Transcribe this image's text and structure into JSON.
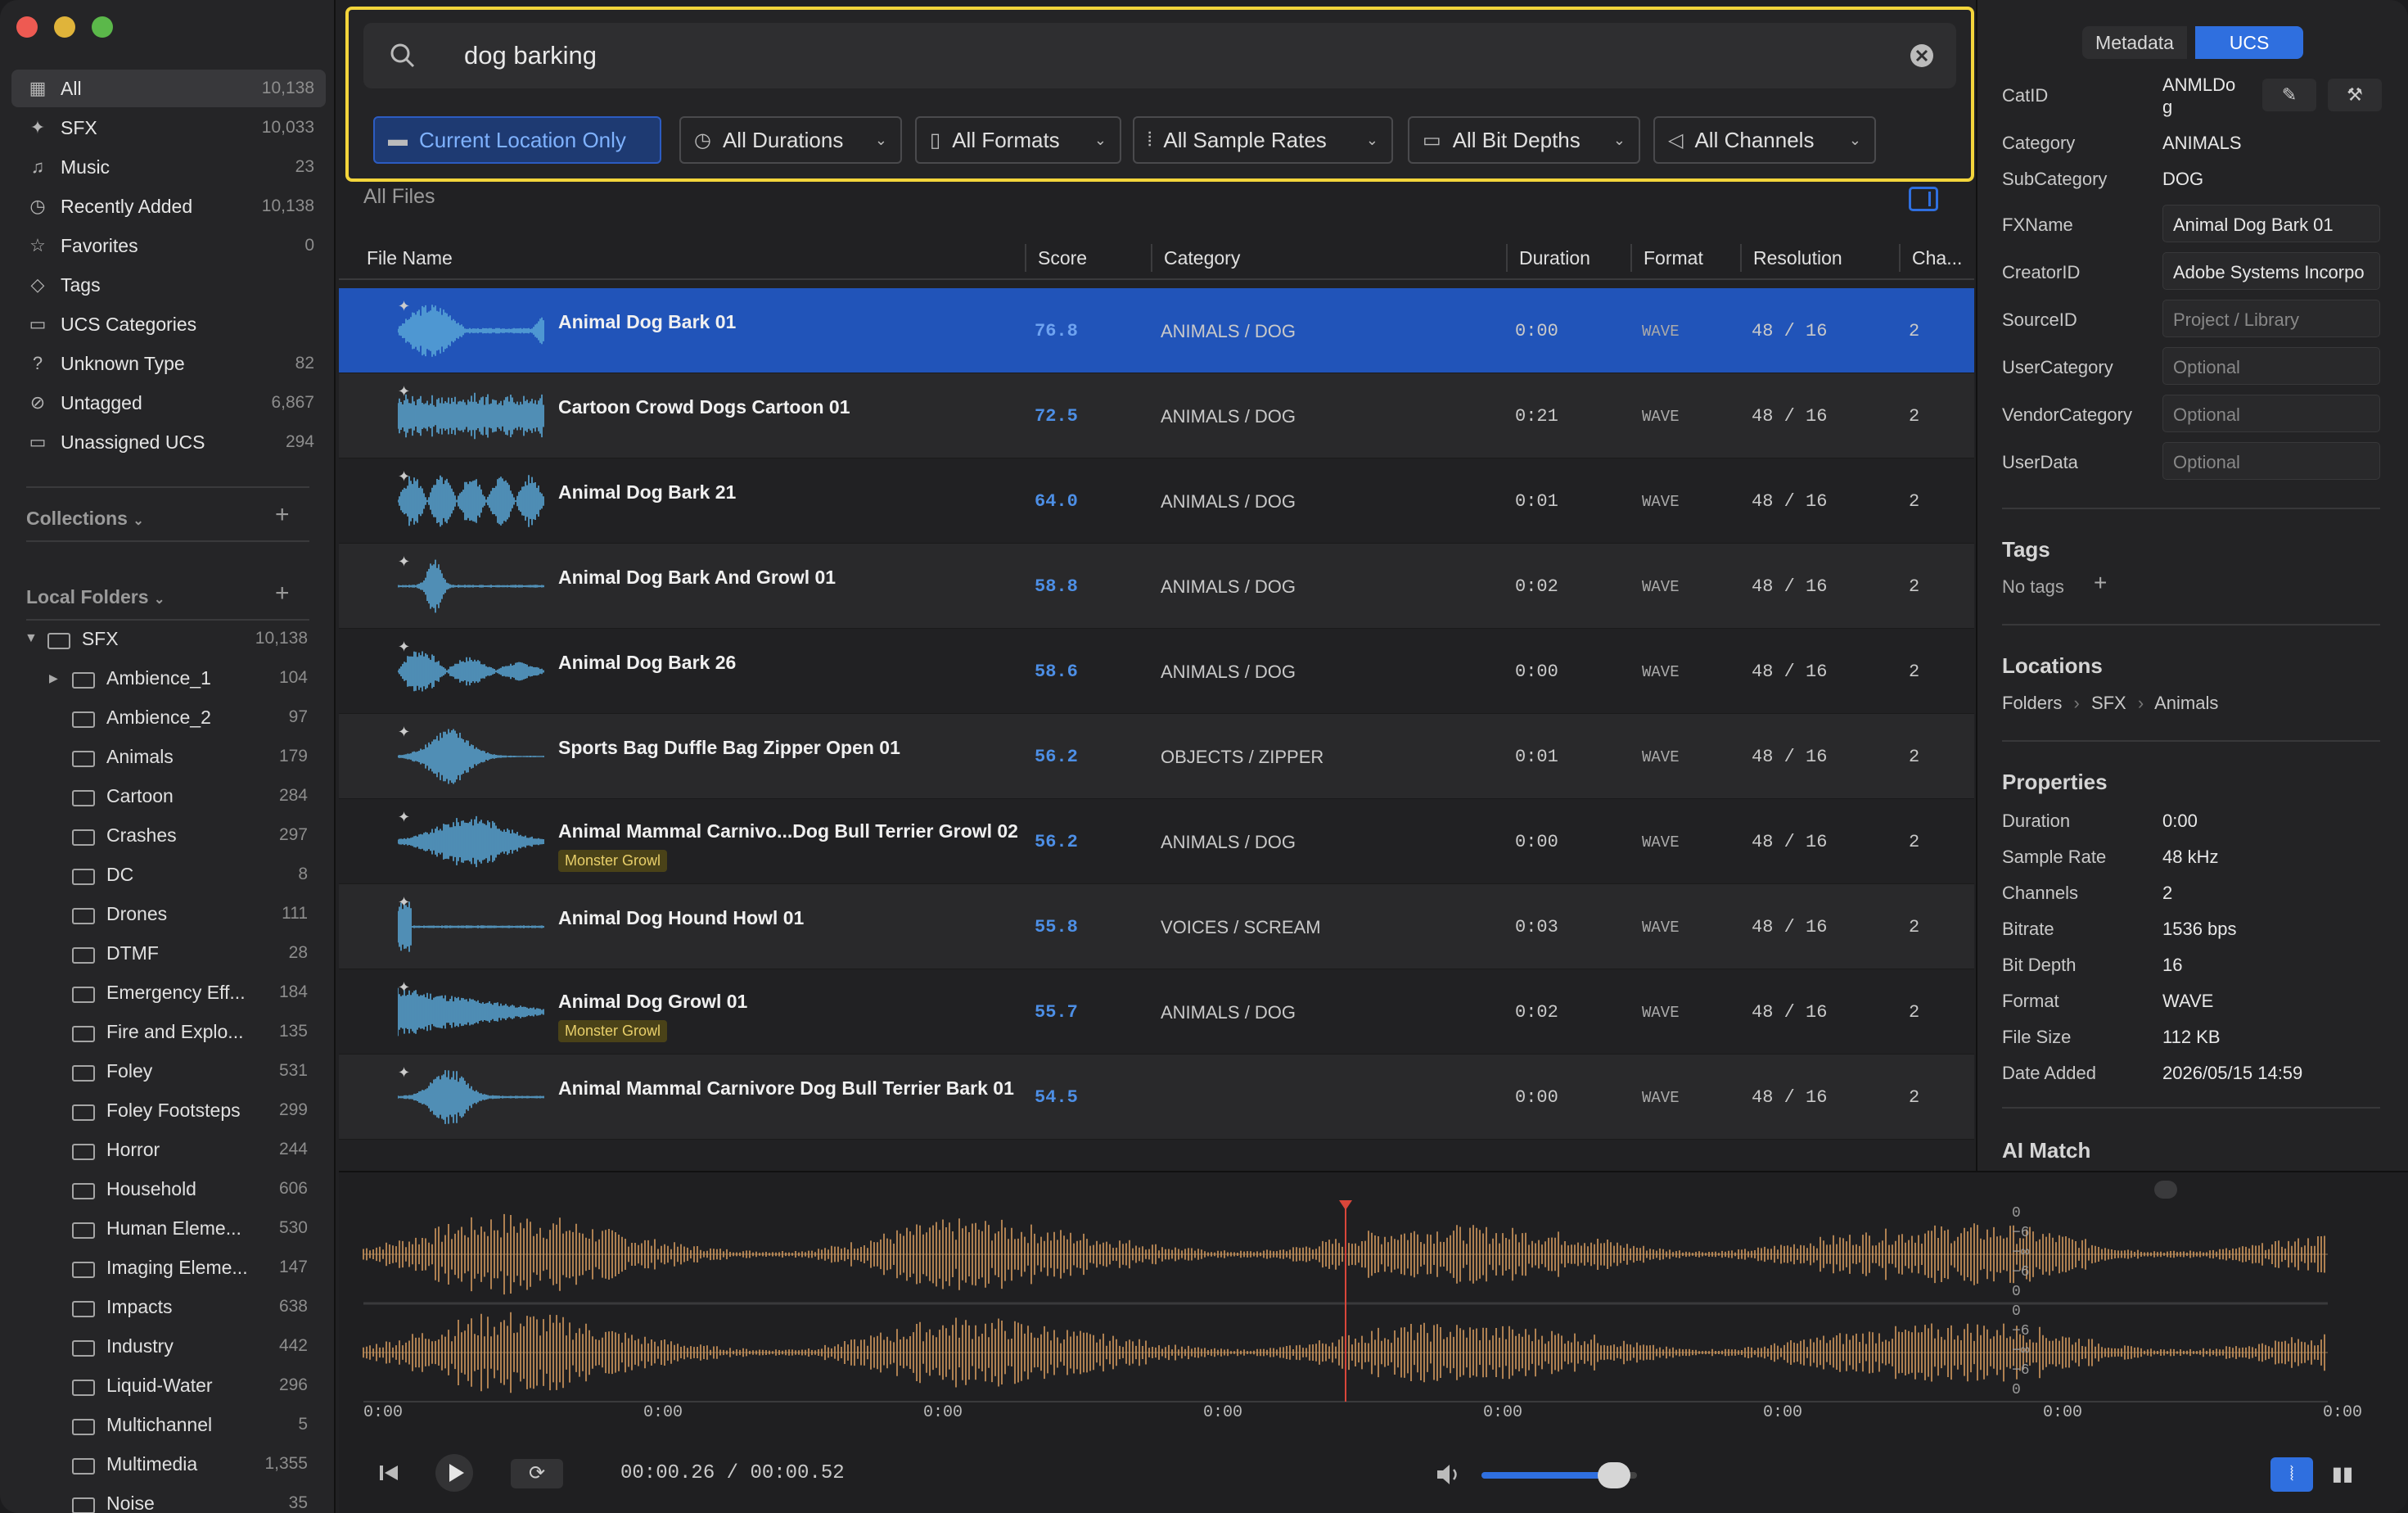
{
  "window": {
    "controls": [
      "close",
      "minimize",
      "zoom"
    ]
  },
  "sidebar": {
    "library": [
      {
        "label": "All",
        "count": "10,138",
        "icon": "grid-icon"
      },
      {
        "label": "SFX",
        "count": "10,033",
        "icon": "sparkle-icon"
      },
      {
        "label": "Music",
        "count": "23",
        "icon": "music-note-icon"
      },
      {
        "label": "Recently Added",
        "count": "10,138",
        "icon": "clock-icon"
      },
      {
        "label": "Favorites",
        "count": "0",
        "icon": "star-icon"
      },
      {
        "label": "Tags",
        "count": "",
        "icon": "tag-icon"
      },
      {
        "label": "UCS Categories",
        "count": "",
        "icon": "folder-icon"
      },
      {
        "label": "Unknown Type",
        "count": "82",
        "icon": "question-icon"
      },
      {
        "label": "Untagged",
        "count": "6,867",
        "icon": "untagged-icon"
      },
      {
        "label": "Unassigned UCS",
        "count": "294",
        "icon": "folder-icon"
      }
    ],
    "collections_label": "Collections",
    "local_folders_label": "Local Folders",
    "root_folder": {
      "label": "SFX",
      "count": "10,138"
    },
    "folders": [
      {
        "label": "Ambience_1",
        "count": "104"
      },
      {
        "label": "Ambience_2",
        "count": "97"
      },
      {
        "label": "Animals",
        "count": "179"
      },
      {
        "label": "Cartoon",
        "count": "284"
      },
      {
        "label": "Crashes",
        "count": "297"
      },
      {
        "label": "DC",
        "count": "8"
      },
      {
        "label": "Drones",
        "count": "111"
      },
      {
        "label": "DTMF",
        "count": "28"
      },
      {
        "label": "Emergency Eff...",
        "count": "184"
      },
      {
        "label": "Fire and Explo...",
        "count": "135"
      },
      {
        "label": "Foley",
        "count": "531"
      },
      {
        "label": "Foley Footsteps",
        "count": "299"
      },
      {
        "label": "Horror",
        "count": "244"
      },
      {
        "label": "Household",
        "count": "606"
      },
      {
        "label": "Human Eleme...",
        "count": "530"
      },
      {
        "label": "Imaging Eleme...",
        "count": "147"
      },
      {
        "label": "Impacts",
        "count": "638"
      },
      {
        "label": "Industry",
        "count": "442"
      },
      {
        "label": "Liquid-Water",
        "count": "296"
      },
      {
        "label": "Multichannel",
        "count": "5"
      },
      {
        "label": "Multimedia",
        "count": "1,355"
      },
      {
        "label": "Noise",
        "count": "35"
      }
    ]
  },
  "search": {
    "query": "dog barking",
    "filters": [
      {
        "label": "Current Location Only",
        "icon": "folder-icon"
      },
      {
        "label": "All Durations",
        "icon": "clock-icon"
      },
      {
        "label": "All Formats",
        "icon": "file-icon"
      },
      {
        "label": "All Sample Rates",
        "icon": "waveform-icon"
      },
      {
        "label": "All Bit Depths",
        "icon": "bit-depth-icon"
      },
      {
        "label": "All Channels",
        "icon": "speaker-icon"
      }
    ]
  },
  "list": {
    "title": "All Files",
    "columns": [
      "File Name",
      "Score",
      "Category",
      "Duration",
      "Format",
      "Resolution",
      "Cha..."
    ],
    "rows": [
      {
        "name": "Animal Dog Bark 01",
        "score": "76.8",
        "category": "ANIMALS / DOG",
        "duration": "0:00",
        "format": "WAVE",
        "resolution": "48 / 16",
        "channels": "2",
        "tag": ""
      },
      {
        "name": "Cartoon Crowd Dogs Cartoon 01",
        "score": "72.5",
        "category": "ANIMALS / DOG",
        "duration": "0:21",
        "format": "WAVE",
        "resolution": "48 / 16",
        "channels": "2",
        "tag": ""
      },
      {
        "name": "Animal Dog Bark 21",
        "score": "64.0",
        "category": "ANIMALS / DOG",
        "duration": "0:01",
        "format": "WAVE",
        "resolution": "48 / 16",
        "channels": "2",
        "tag": ""
      },
      {
        "name": "Animal Dog Bark And Growl 01",
        "score": "58.8",
        "category": "ANIMALS / DOG",
        "duration": "0:02",
        "format": "WAVE",
        "resolution": "48 / 16",
        "channels": "2",
        "tag": ""
      },
      {
        "name": "Animal Dog Bark 26",
        "score": "58.6",
        "category": "ANIMALS / DOG",
        "duration": "0:00",
        "format": "WAVE",
        "resolution": "48 / 16",
        "channels": "2",
        "tag": ""
      },
      {
        "name": "Sports Bag Duffle Bag Zipper Open 01",
        "score": "56.2",
        "category": "OBJECTS / ZIPPER",
        "duration": "0:01",
        "format": "WAVE",
        "resolution": "48 / 16",
        "channels": "2",
        "tag": ""
      },
      {
        "name": "Animal Mammal Carnivo...Dog Bull Terrier Growl 02",
        "score": "56.2",
        "category": "ANIMALS / DOG",
        "duration": "0:00",
        "format": "WAVE",
        "resolution": "48 / 16",
        "channels": "2",
        "tag": "Monster Growl"
      },
      {
        "name": "Animal Dog Hound Howl 01",
        "score": "55.8",
        "category": "VOICES / SCREAM",
        "duration": "0:03",
        "format": "WAVE",
        "resolution": "48 / 16",
        "channels": "2",
        "tag": ""
      },
      {
        "name": "Animal Dog Growl 01",
        "score": "55.7",
        "category": "ANIMALS / DOG",
        "duration": "0:02",
        "format": "WAVE",
        "resolution": "48 / 16",
        "channels": "2",
        "tag": "Monster Growl"
      },
      {
        "name": "Animal Mammal Carnivore Dog Bull Terrier Bark 01",
        "score": "54.5",
        "category": "",
        "duration": "0:00",
        "format": "WAVE",
        "resolution": "48 / 16",
        "channels": "2",
        "tag": ""
      }
    ]
  },
  "inspector": {
    "tabs": [
      "Metadata",
      "UCS"
    ],
    "active_tab": "UCS",
    "catid_label": "CatID",
    "catid_value": "ANMLDo\ng",
    "category_label": "Category",
    "category_value": "ANIMALS",
    "subcategory_label": "SubCategory",
    "subcategory_value": "DOG",
    "fxname_label": "FXName",
    "fxname_value": "Animal Dog Bark 01",
    "creatorid_label": "CreatorID",
    "creatorid_value": "Adobe Systems Incorpo",
    "sourceid_label": "SourceID",
    "sourceid_placeholder": "Project / Library",
    "usercategory_label": "UserCategory",
    "vendorcategory_label": "VendorCategory",
    "userdata_label": "UserData",
    "optional_placeholder": "Optional",
    "tags_heading": "Tags",
    "no_tags": "No tags",
    "locations_heading": "Locations",
    "loc_folders": "Folders",
    "loc_sfx": "SFX",
    "loc_animals": "Animals",
    "properties_heading": "Properties",
    "properties": [
      {
        "label": "Duration",
        "value": "0:00"
      },
      {
        "label": "Sample Rate",
        "value": "48 kHz"
      },
      {
        "label": "Channels",
        "value": "2"
      },
      {
        "label": "Bitrate",
        "value": "1536 bps"
      },
      {
        "label": "Bit Depth",
        "value": "16"
      },
      {
        "label": "Format",
        "value": "WAVE"
      },
      {
        "label": "File Size",
        "value": "112 KB"
      },
      {
        "label": "Date Added",
        "value": "2026/05/15 14:59"
      }
    ],
    "ai_match_heading": "AI Match"
  },
  "player": {
    "current_time": "00:00.26",
    "separator": "/",
    "total_time": "00:00.52",
    "timeline_labels": [
      "0:00",
      "0:00",
      "0:00",
      "0:00",
      "0:00",
      "0:00",
      "0:00",
      "0:00"
    ],
    "db_labels_top": [
      "0",
      "−6",
      "−∞",
      "−6",
      "0"
    ],
    "db_labels_bottom": [
      "0",
      "−6",
      "−∞",
      "−6",
      "0"
    ],
    "volume": 0.85,
    "playhead": 0.5,
    "waveform_color": "#c8925a",
    "accent": "#2f6fdf"
  }
}
